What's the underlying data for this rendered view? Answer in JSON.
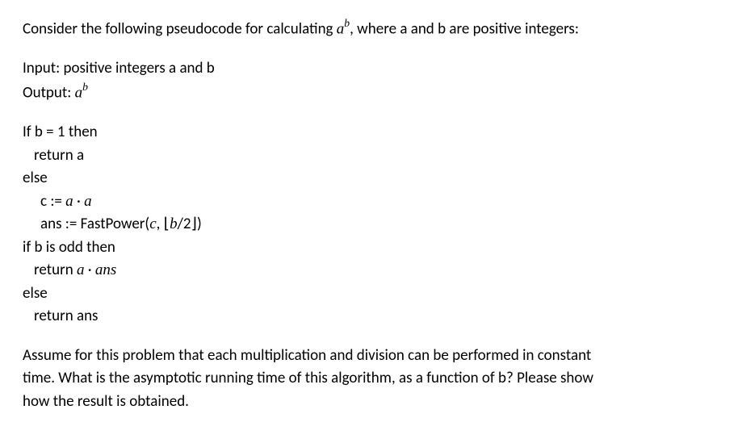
{
  "intro": {
    "t1": "Consider the following pseudocode for calculating ",
    "a": "a",
    "b": "b",
    "t2": ", where a and b are positive integers:"
  },
  "io": {
    "input": "Input: positive integers a and b",
    "output_label": "Output: ",
    "a": "a",
    "b": "b"
  },
  "code": {
    "l1": "If b = 1 then",
    "l2": "return a",
    "l3": "else",
    "l4_pre": "c := ",
    "l4_a1": "a",
    "l4_dot": " · ",
    "l4_a2": "a",
    "l5_pre": "ans := FastPower(",
    "l5_c": "c",
    "l5_mid": ", ⌊",
    "l5_frac": "b",
    "l5_slash": "/2⌋)",
    "l6": "if b is odd then",
    "l7_pre": "return ",
    "l7_a": "a",
    "l7_dot": " · ",
    "l7_ans": "ans",
    "l8": "else",
    "l9": "return ans"
  },
  "question": {
    "l1": "Assume for this problem that each multiplication and division can be performed in constant",
    "l2": "time. What is the asymptotic running time of this algorithm, as a function of b? Please show",
    "l3": "how the result is obtained."
  }
}
